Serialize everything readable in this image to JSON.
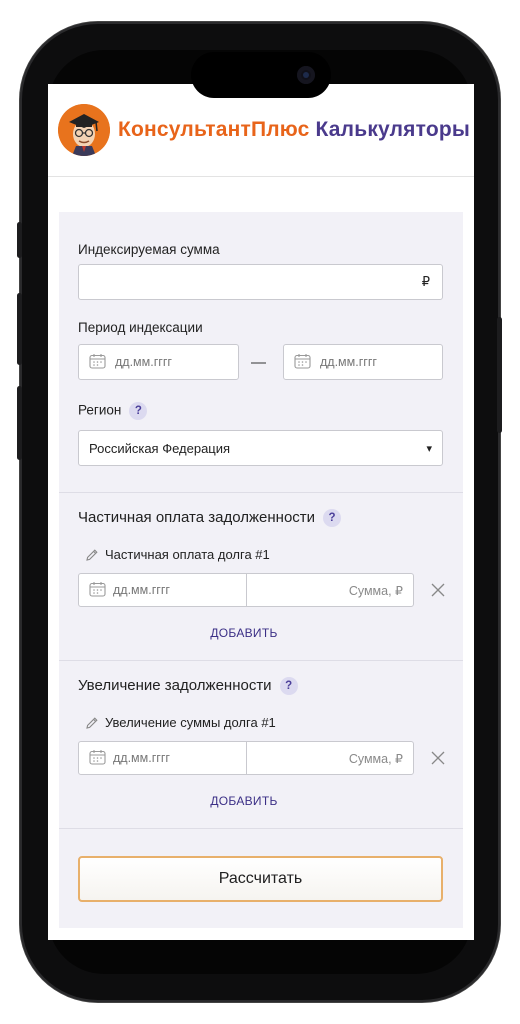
{
  "header": {
    "brand_part1": "КонсультантПлюс",
    "brand_part2": "Калькуляторы"
  },
  "form": {
    "amount_label": "Индексируемая сумма",
    "amount_currency": "₽",
    "period_label": "Период индексации",
    "date_placeholder": "дд.мм.гггг",
    "period_separator": "—",
    "region_label": "Регион",
    "help_symbol": "?",
    "region_value": "Российская Федерация",
    "select_arrow": "▾"
  },
  "partial_payment": {
    "title": "Частичная оплата задолженности",
    "item_title": "Частичная оплата долга #1",
    "date_placeholder": "дд.мм.гггг",
    "sum_placeholder": "Сумма, ₽",
    "add_label": "ДОБАВИТЬ"
  },
  "debt_increase": {
    "title": "Увеличение задолженности",
    "item_title": "Увеличение суммы долга #1",
    "date_placeholder": "дд.мм.гггг",
    "sum_placeholder": "Сумма, ₽",
    "add_label": "ДОБАВИТЬ"
  },
  "actions": {
    "calculate_label": "Рассчитать"
  },
  "colors": {
    "brand_orange": "#e8641a",
    "brand_purple": "#4a3a8c",
    "panel_bg": "#f2f1f7",
    "button_border": "#e8b06b"
  }
}
